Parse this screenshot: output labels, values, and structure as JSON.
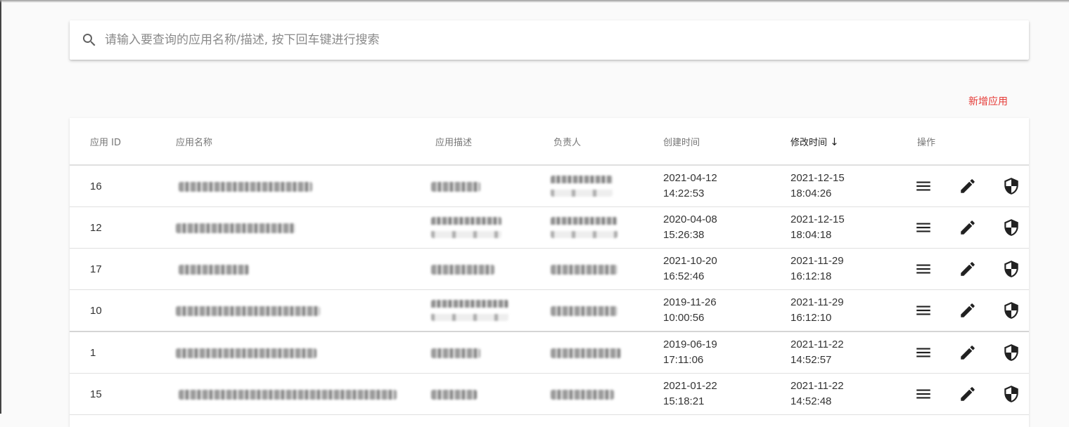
{
  "search": {
    "placeholder": "请输入要查询的应用名称/描述, 按下回车键进行搜索",
    "icon": "search-icon"
  },
  "actions": {
    "add_label": "新增应用"
  },
  "table": {
    "headers": {
      "id": "应用 ID",
      "name": "应用名称",
      "desc": "应用描述",
      "owner": "负责人",
      "created": "创建时间",
      "modified": "修改时间",
      "sort_arrow": "↓",
      "ops": "操作"
    },
    "sorted_column": "modified",
    "row_icons": [
      "menu-icon",
      "edit-icon",
      "shield-icon"
    ],
    "rows": [
      {
        "id": "16",
        "created_date": "2021-04-12",
        "created_time": "14:22:53",
        "modified_date": "2021-12-15",
        "modified_time": "18:04:26"
      },
      {
        "id": "12",
        "created_date": "2020-04-08",
        "created_time": "15:26:38",
        "modified_date": "2021-12-15",
        "modified_time": "18:04:18"
      },
      {
        "id": "17",
        "created_date": "2021-10-20",
        "created_time": "16:52:46",
        "modified_date": "2021-11-29",
        "modified_time": "16:12:18"
      },
      {
        "id": "10",
        "created_date": "2019-11-26",
        "created_time": "10:00:56",
        "modified_date": "2021-11-29",
        "modified_time": "16:12:10"
      },
      {
        "id": "1",
        "created_date": "2019-06-19",
        "created_time": "17:11:06",
        "modified_date": "2021-11-22",
        "modified_time": "14:52:57"
      },
      {
        "id": "15",
        "created_date": "2021-01-22",
        "created_time": "15:18:21",
        "modified_date": "2021-11-22",
        "modified_time": "14:52:48"
      }
    ]
  },
  "colors": {
    "accent": "#e53935",
    "text": "#333333",
    "header": "#757575"
  }
}
